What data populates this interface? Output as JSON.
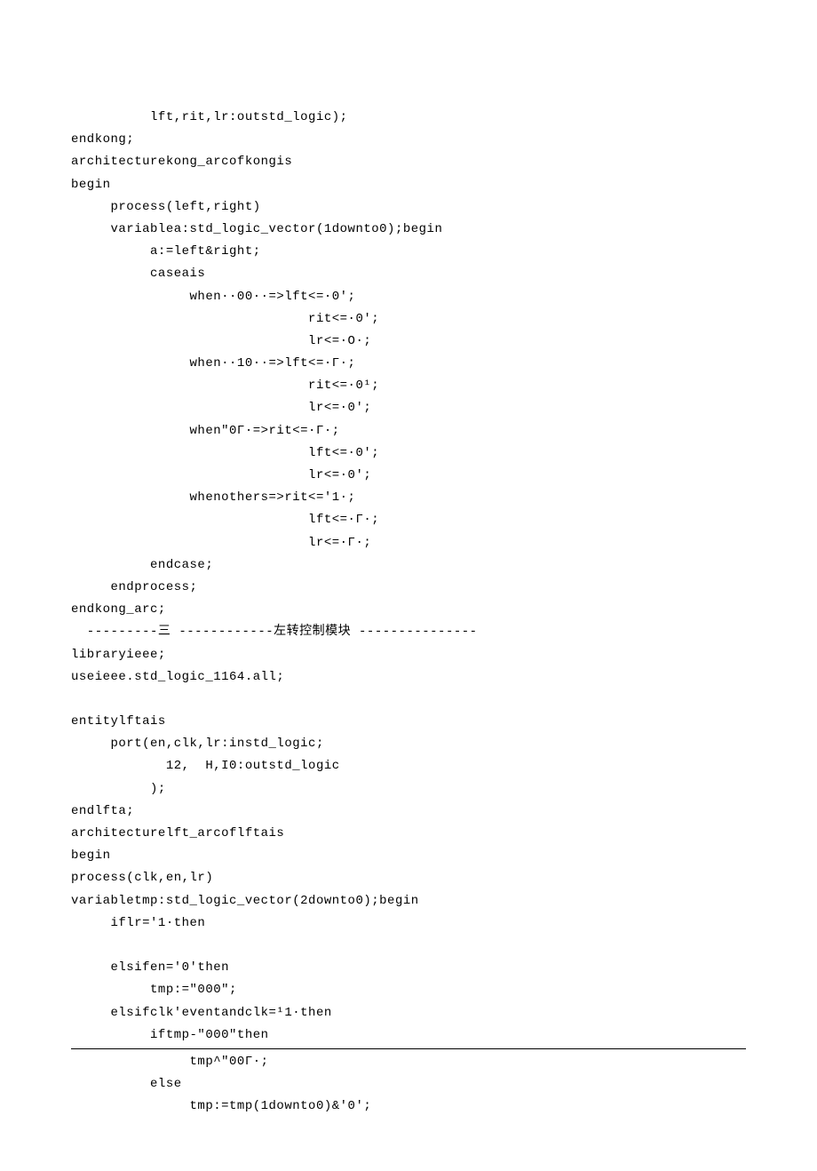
{
  "lines": [
    "          lft,rit,lr:outstd_logic);",
    "endkong;",
    "architecturekong_arcofkongis",
    "begin",
    "     process(left,right)",
    "     variablea:std_logic_vector(1downto0);begin",
    "          a:=left&right;",
    "          caseais",
    "               when··00··=>lft<=·0';",
    "                              rit<=·0';",
    "                              lr<=·O·;",
    "               when··10··=>lft<=·Г·;",
    "                              rit<=·0¹;",
    "                              lr<=·0';",
    "               when\"0Г·=>rit<=·Г·;",
    "                              lft<=·0';",
    "                              lr<=·0';",
    "               whenothers=>rit<='1·;",
    "                              lft<=·Г·;",
    "                              lr<=·Г·;",
    "          endcase;",
    "     endprocess;",
    "endkong_arc;"
  ],
  "section_divider": "  ---------三 ------------左转控制模块 ---------------",
  "lines2": [
    "libraryieee;",
    "useieee.std_logic_1164.all;",
    "",
    "entitylftais",
    "     port(en,clk,lr:instd_logic;",
    "            12,  H,I0:outstd_logic",
    "          );",
    "endlfta;",
    "architecturelft_arcoflftais",
    "begin",
    "process(clk,en,lr)",
    "variabletmp:std_logic_vector(2downto0);begin",
    "     iflr='1·then",
    "",
    "     elsifen='0'then",
    "          tmp:=\"000\";",
    "     elsifclk'eventandclk=¹1·then",
    "          iftmp-\"000\"then"
  ],
  "lines3": [
    "               tmp^\"00Г·;",
    "          else",
    "               tmp:=tmp(1downto0)&'0';"
  ]
}
